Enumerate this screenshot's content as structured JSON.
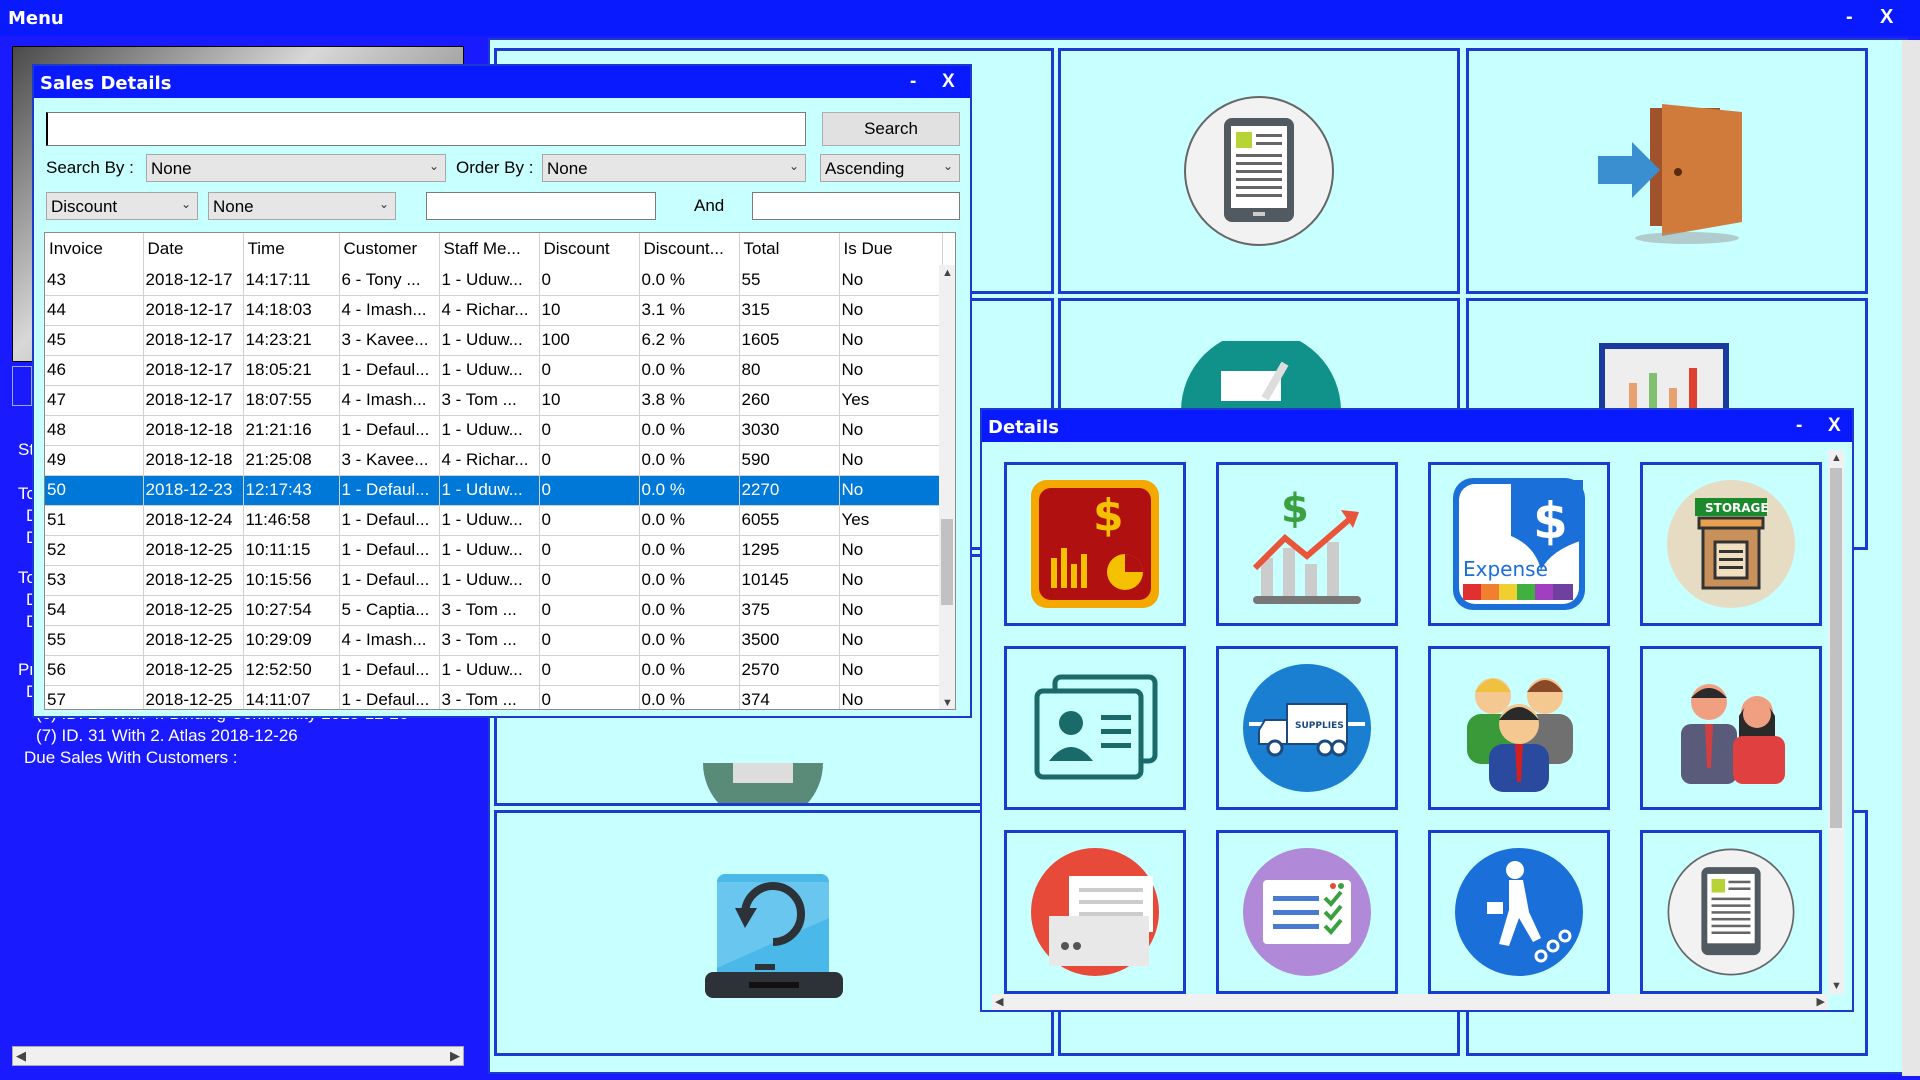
{
  "main": {
    "title": "Menu",
    "minimize": "-",
    "close": "X"
  },
  "left_panel": {
    "lines": [
      "St",
      "To",
      "D",
      "D",
      "To",
      "D",
      "D",
      "Pr",
      "D"
    ],
    "overlapped_line": "(6) ID. 28 With 4. Binding Community    2018-12-26",
    "due_line": "(7) ID. 31 With 2. Atlas     2018-12-26",
    "due_heading": "Due Sales With Customers :"
  },
  "sales_details": {
    "title": "Sales Details",
    "minimize": "-",
    "close": "X",
    "search_value": "",
    "search_button": "Search",
    "search_by_label": "Search By :",
    "search_by_value": "None",
    "order_by_label": "Order By :",
    "order_by_value": "None",
    "sort_value": "Ascending",
    "filter_field": "Discount",
    "filter_op": "None",
    "range_from": "",
    "and_label": "And",
    "range_to": "",
    "columns": [
      "Invoice",
      "Date",
      "Time",
      "Customer",
      "Staff Me...",
      "Discount",
      "Discount...",
      "Total",
      "Is Due"
    ],
    "rows": [
      [
        "43",
        "2018-12-17",
        "14:17:11",
        "6 - Tony ...",
        "1 - Uduw...",
        "0",
        "0.0 %",
        "55",
        "No"
      ],
      [
        "44",
        "2018-12-17",
        "14:18:03",
        "4 - Imash...",
        "4 - Richar...",
        "10",
        "3.1 %",
        "315",
        "No"
      ],
      [
        "45",
        "2018-12-17",
        "14:23:21",
        "3 - Kavee...",
        "1 - Uduw...",
        "100",
        "6.2 %",
        "1605",
        "No"
      ],
      [
        "46",
        "2018-12-17",
        "18:05:21",
        "1 - Defaul...",
        "1 - Uduw...",
        "0",
        "0.0 %",
        "80",
        "No"
      ],
      [
        "47",
        "2018-12-17",
        "18:07:55",
        "4 - Imash...",
        "3 - Tom ...",
        "10",
        "3.8 %",
        "260",
        "Yes"
      ],
      [
        "48",
        "2018-12-18",
        "21:21:16",
        "1 - Defaul...",
        "1 - Uduw...",
        "0",
        "0.0 %",
        "3030",
        "No"
      ],
      [
        "49",
        "2018-12-18",
        "21:25:08",
        "3 - Kavee...",
        "4 - Richar...",
        "0",
        "0.0 %",
        "590",
        "No"
      ],
      [
        "50",
        "2018-12-23",
        "12:17:43",
        "1 - Defaul...",
        "1 - Uduw...",
        "0",
        "0.0 %",
        "2270",
        "No"
      ],
      [
        "51",
        "2018-12-24",
        "11:46:58",
        "1 - Defaul...",
        "1 - Uduw...",
        "0",
        "0.0 %",
        "6055",
        "Yes"
      ],
      [
        "52",
        "2018-12-25",
        "10:11:15",
        "1 - Defaul...",
        "1 - Uduw...",
        "0",
        "0.0 %",
        "1295",
        "No"
      ],
      [
        "53",
        "2018-12-25",
        "10:15:56",
        "1 - Defaul...",
        "1 - Uduw...",
        "0",
        "0.0 %",
        "10145",
        "No"
      ],
      [
        "54",
        "2018-12-25",
        "10:27:54",
        "5 - Captia...",
        "3 - Tom ...",
        "0",
        "0.0 %",
        "375",
        "No"
      ],
      [
        "55",
        "2018-12-25",
        "10:29:09",
        "4 - Imash...",
        "3 - Tom ...",
        "0",
        "0.0 %",
        "3500",
        "No"
      ],
      [
        "56",
        "2018-12-25",
        "12:52:50",
        "1 - Defaul...",
        "1 - Uduw...",
        "0",
        "0.0 %",
        "2570",
        "No"
      ],
      [
        "57",
        "2018-12-25",
        "14:11:07",
        "1 - Defaul...",
        "3 - Tom ...",
        "0",
        "0.0 %",
        "374",
        "No"
      ]
    ],
    "selected_invoice": "50"
  },
  "details": {
    "title": "Details",
    "minimize": "-",
    "close": "X",
    "expense_label": "Expense",
    "storage_label": "STORAGE",
    "supplies_label": "SUPPLIES",
    "tiles": [
      "sales-report-icon",
      "profit-chart-icon",
      "expense-icon",
      "storage-icon",
      "contact-card-icon",
      "supplies-truck-icon",
      "customers-icon",
      "staff-icon",
      "printer-icon",
      "checklist-icon",
      "business-growth-icon",
      "document-tablet-icon"
    ]
  },
  "colors": {
    "titlebar": "#0a1aff",
    "panel": "#c8ffff",
    "border": "#1a3ad0",
    "selected": "#0078d7"
  }
}
